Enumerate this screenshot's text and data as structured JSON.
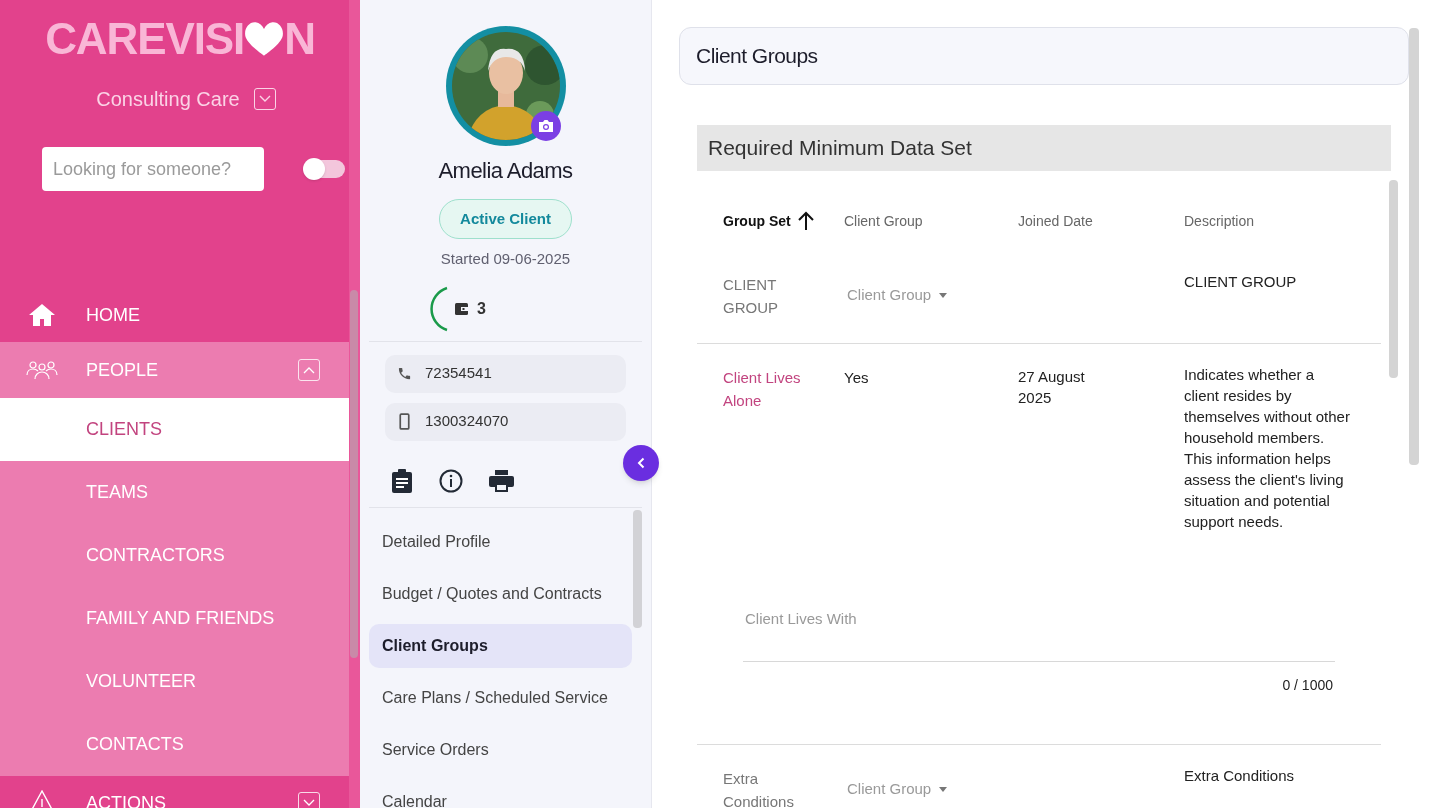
{
  "logo": {
    "before": "CAREVISI",
    "after": "N"
  },
  "organisation": {
    "name": "Consulting Care"
  },
  "search": {
    "placeholder": "Looking for someone?"
  },
  "toggle": {
    "on": false
  },
  "nav": [
    {
      "label": "HOME",
      "kind": "link"
    },
    {
      "label": "PEOPLE",
      "kind": "group",
      "expanded": true,
      "children": [
        {
          "label": "CLIENTS",
          "selected": true
        },
        {
          "label": "TEAMS",
          "selected": false
        },
        {
          "label": "CONTRACTORS",
          "selected": false
        },
        {
          "label": "FAMILY AND FRIENDS",
          "selected": false
        },
        {
          "label": "VOLUNTEER",
          "selected": false
        },
        {
          "label": "CONTACTS",
          "selected": false
        }
      ]
    },
    {
      "label": "ACTIONS",
      "kind": "group",
      "expanded": false
    }
  ],
  "client": {
    "name": "Amelia Adams",
    "status": "Active Client",
    "started": "Started 09-06-2025",
    "wallet_count": "3",
    "phone": "72354541",
    "mobile": "1300324070"
  },
  "profile_menu": [
    {
      "label": "Detailed Profile",
      "selected": false
    },
    {
      "label": "Budget / Quotes and Contracts",
      "selected": false
    },
    {
      "label": "Client Groups",
      "selected": true
    },
    {
      "label": "Care Plans / Scheduled Service",
      "selected": false
    },
    {
      "label": "Service Orders",
      "selected": false
    },
    {
      "label": "Calendar",
      "selected": false
    }
  ],
  "page_title": "Client Groups",
  "section_title": "Required Minimum Data Set",
  "table": {
    "columns": [
      {
        "label": "Group Set",
        "sorted": true
      },
      {
        "label": "Client Group",
        "sorted": false
      },
      {
        "label": "Joined Date",
        "sorted": false
      },
      {
        "label": "Description",
        "sorted": false
      }
    ],
    "rows": [
      {
        "group_set": "CLIENT GROUP",
        "active": false,
        "client_group": {
          "kind": "dropdown",
          "placeholder": "Client Group"
        },
        "joined_date": "",
        "description": "CLIENT GROUP"
      },
      {
        "group_set": "Client Lives Alone",
        "active": true,
        "client_group": {
          "kind": "text",
          "value": "Yes"
        },
        "joined_date": "27 August 2025",
        "description": "Indicates whether a client resides by themselves without other household members. This information helps assess the client's living situation and potential support needs.",
        "extra_field": {
          "label": "Client Lives With",
          "counter": "0 / 1000"
        }
      },
      {
        "group_set": "Extra Conditions",
        "active": false,
        "client_group": {
          "kind": "dropdown",
          "placeholder": "Client Group"
        },
        "joined_date": "",
        "description": "Extra Conditions"
      }
    ]
  }
}
